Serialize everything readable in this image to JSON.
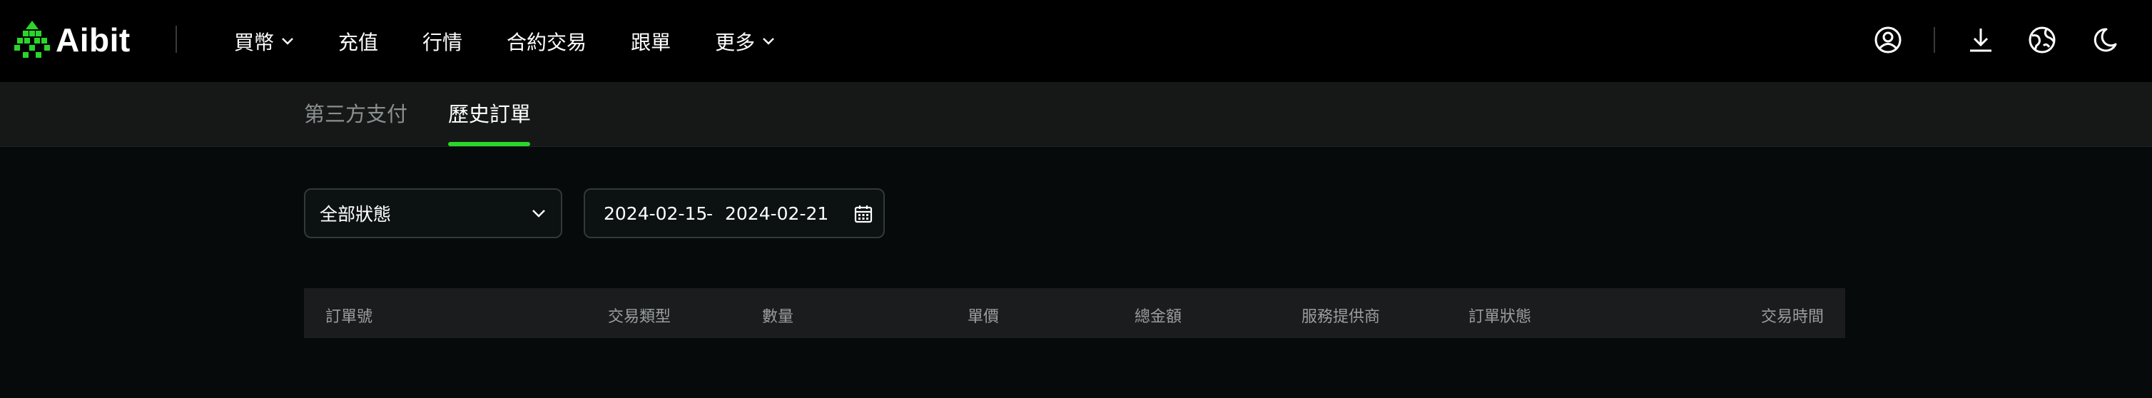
{
  "brand": {
    "name": "Aibit",
    "accent": "#2ad62a"
  },
  "nav": {
    "items": [
      {
        "label": "買幣",
        "dropdown": true
      },
      {
        "label": "充值",
        "dropdown": false
      },
      {
        "label": "行情",
        "dropdown": false
      },
      {
        "label": "合約交易",
        "dropdown": false
      },
      {
        "label": "跟單",
        "dropdown": false
      },
      {
        "label": "更多",
        "dropdown": true
      }
    ],
    "icons": [
      "user-icon",
      "download-icon",
      "globe-icon",
      "moon-icon"
    ]
  },
  "tabs": [
    {
      "label": "第三方支付",
      "active": false
    },
    {
      "label": "歷史訂單",
      "active": true
    }
  ],
  "filters": {
    "status": "全部狀態",
    "date_start": "2024-02-15",
    "date_separator": "-",
    "date_end": "2024-02-21"
  },
  "table": {
    "columns": [
      "訂單號",
      "交易類型",
      "數量",
      "單價",
      "總金額",
      "服務提供商",
      "訂單狀態",
      "交易時間"
    ]
  }
}
